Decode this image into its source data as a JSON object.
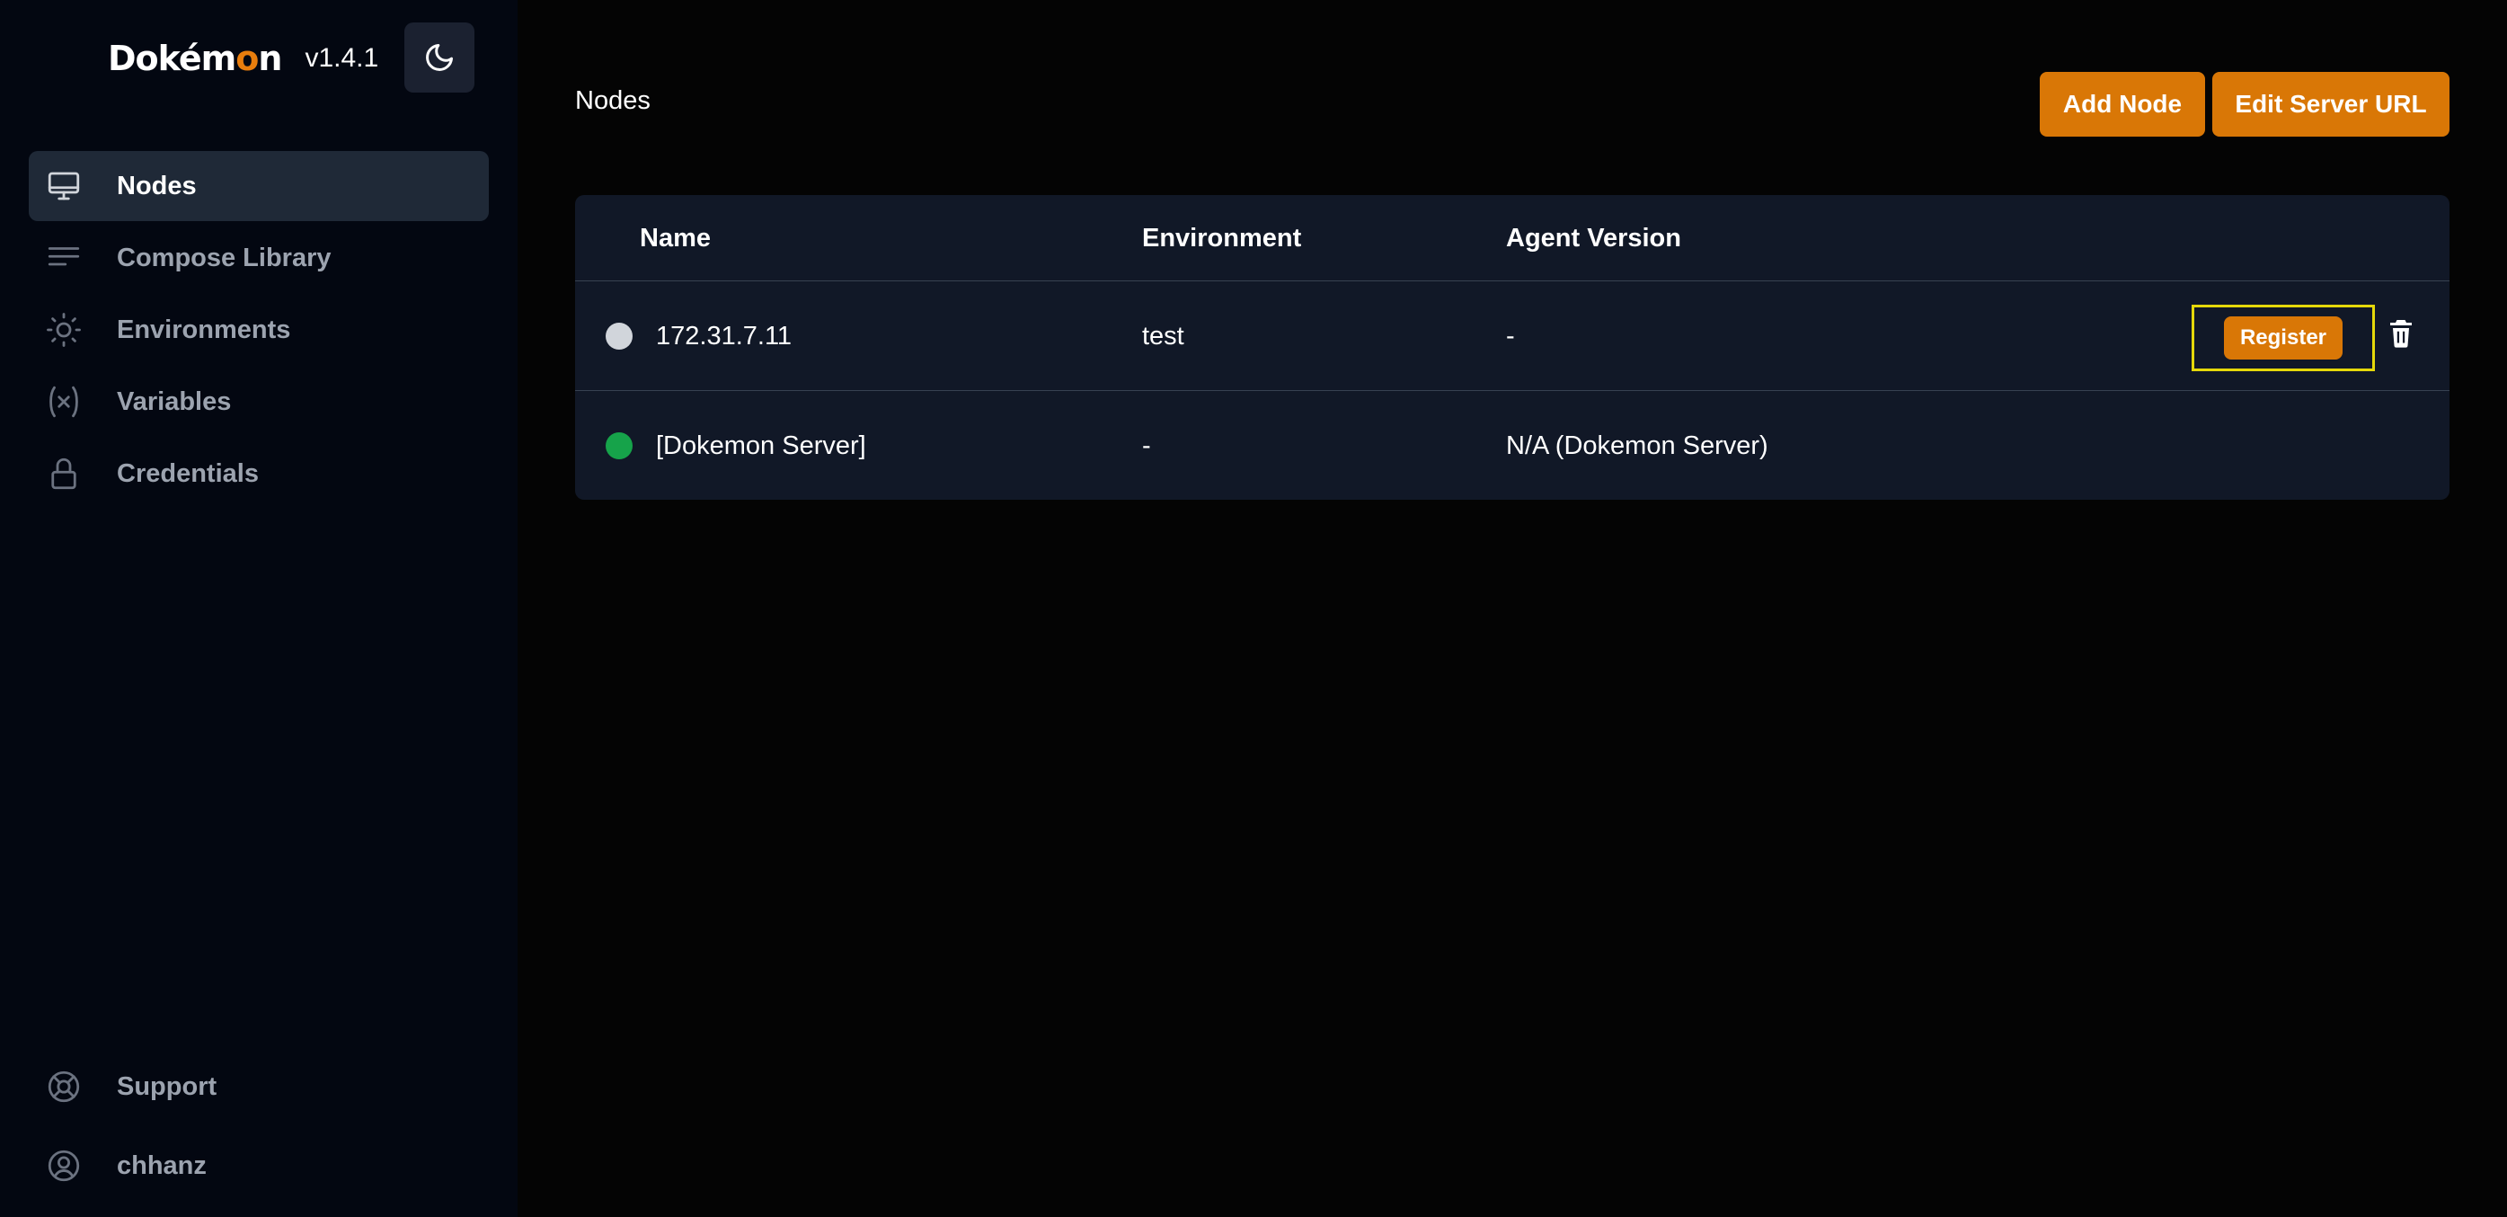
{
  "app": {
    "logo_parts": [
      "Dokém",
      "o",
      "n"
    ],
    "version": "v1.4.1"
  },
  "sidebar": {
    "items": [
      {
        "label": "Nodes",
        "icon": "monitor-icon",
        "active": true
      },
      {
        "label": "Compose Library",
        "icon": "lines-icon",
        "active": false
      },
      {
        "label": "Environments",
        "icon": "sun-icon",
        "active": false
      },
      {
        "label": "Variables",
        "icon": "variable-icon",
        "active": false
      },
      {
        "label": "Credentials",
        "icon": "lock-icon",
        "active": false
      }
    ],
    "bottom": [
      {
        "label": "Support",
        "icon": "lifebuoy-icon"
      },
      {
        "label": "chhanz",
        "icon": "user-circle-icon"
      }
    ],
    "theme_icon": "moon-icon"
  },
  "main": {
    "title": "Nodes",
    "add_node_label": "Add Node",
    "edit_server_url_label": "Edit Server URL"
  },
  "table": {
    "headers": [
      "Name",
      "Environment",
      "Agent Version"
    ],
    "rows": [
      {
        "status_color": "#d1d5db",
        "name": "172.31.7.11",
        "environment": "test",
        "agent_version": "-",
        "register_label": "Register",
        "has_actions": true
      },
      {
        "status_color": "#16a34a",
        "name": "[Dokemon Server]",
        "environment": "-",
        "agent_version": "N/A (Dokemon Server)",
        "has_actions": false
      }
    ]
  },
  "colors": {
    "accent": "#d97706",
    "sidebar_bg": "#030711",
    "card_bg": "#111827",
    "highlight_frame": "#e5d80a"
  }
}
